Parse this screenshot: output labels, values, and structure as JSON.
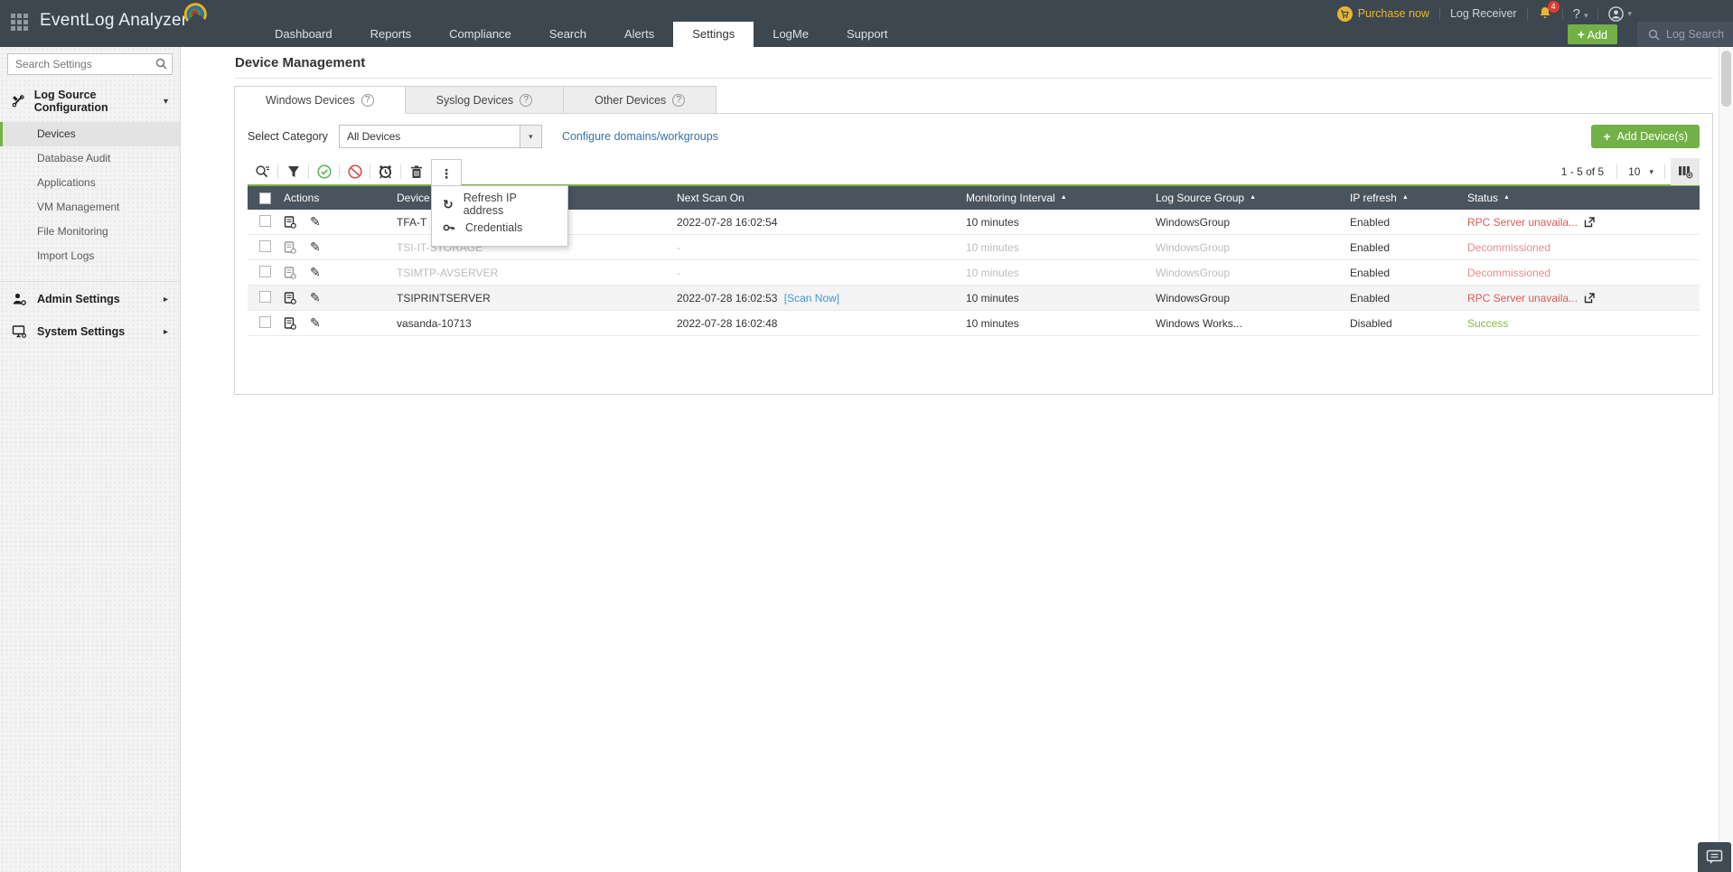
{
  "topbar": {
    "logo": "EventLog Analyzer",
    "nav": [
      "Dashboard",
      "Reports",
      "Compliance",
      "Search",
      "Alerts",
      "Settings",
      "LogMe",
      "Support"
    ],
    "purchase_now": "Purchase now",
    "log_receiver": "Log Receiver",
    "notification_count": "4",
    "help_label": "?",
    "add_label": "Add",
    "log_search_label": "Log Search"
  },
  "sidebar": {
    "search_placeholder": "Search Settings",
    "log_source_configuration": "Log Source Configuration",
    "items": [
      "Devices",
      "Database Audit",
      "Applications",
      "VM Management",
      "File Monitoring",
      "Import Logs"
    ],
    "admin_settings": "Admin Settings",
    "system_settings": "System Settings"
  },
  "main": {
    "title": "Device Management",
    "tabs": [
      "Windows Devices",
      "Syslog Devices",
      "Other Devices"
    ],
    "select_category_label": "Select Category",
    "category_value": "All Devices",
    "configure_link": "Configure domains/workgroups",
    "add_device_label": "Add Device(s)",
    "pagination": {
      "range": "1 - 5 of 5",
      "page_size": "10"
    },
    "table": {
      "columns": {
        "actions": "Actions",
        "device": "Device",
        "next_scan": "Next Scan On",
        "interval": "Monitoring Interval",
        "group": "Log Source Group",
        "ip_refresh": "IP refresh",
        "status": "Status"
      },
      "rows": [
        {
          "device": "TFA-T",
          "next_scan": "2022-07-28 16:02:54",
          "interval": "10 minutes",
          "group": "WindowsGroup",
          "ip_refresh": "Enabled",
          "status": "RPC Server unavaila..."
        },
        {
          "device": "TSI-IT-STORAGE",
          "next_scan": "-",
          "interval": "10 minutes",
          "group": "WindowsGroup",
          "ip_refresh": "Enabled",
          "status": "Decommissioned"
        },
        {
          "device": "TSIMTP-AVSERVER",
          "next_scan": "-",
          "interval": "10 minutes",
          "group": "WindowsGroup",
          "ip_refresh": "Enabled",
          "status": "Decommissioned"
        },
        {
          "device": "TSIPRINTSERVER",
          "next_scan": "2022-07-28 16:02:53",
          "scan_now": "[Scan Now]",
          "interval": "10 minutes",
          "group": "WindowsGroup",
          "ip_refresh": "Enabled",
          "status": "RPC Server unavaila..."
        },
        {
          "device": "vasanda-10713",
          "next_scan": "2022-07-28 16:02:48",
          "interval": "10 minutes",
          "group": "Windows Works...",
          "ip_refresh": "Disabled",
          "status": "Success"
        }
      ]
    },
    "context_menu": {
      "refresh": "Refresh IP address",
      "credentials": "Credentials"
    }
  },
  "colors": {
    "topbar_bg": "#3c4750",
    "accent_green": "#72b147",
    "table_header_bg": "#4a545e",
    "error_red": "#dd5a5a",
    "success_green": "#8ab84a",
    "link_blue": "#3672ab",
    "purchase_gold": "#e9b62e",
    "selected_marker": "#76b33e"
  }
}
